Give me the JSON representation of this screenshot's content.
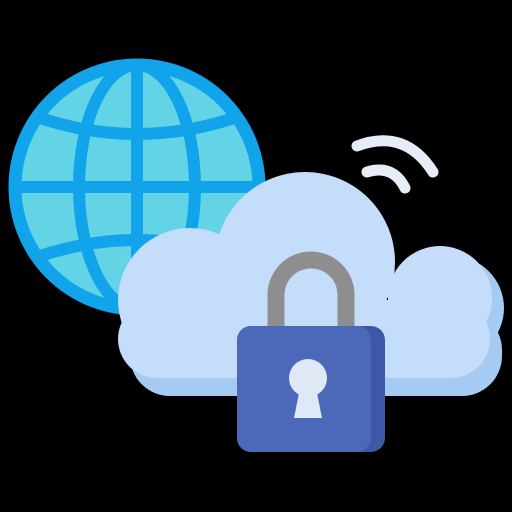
{
  "illustration": {
    "icons": [
      "globe-icon",
      "cloud-icon",
      "wifi-icon",
      "padlock-icon",
      "keyhole-icon"
    ],
    "colors": {
      "background": "#000000",
      "globe_fill": "#63d4e5",
      "globe_lines": "#12a4ea",
      "cloud": "#c4ddfa",
      "cloud_shadow": "#a6cbf3",
      "wifi": "#e6edf7",
      "lock_body": "#4b69b8",
      "lock_shade": "#3d58a6",
      "shackle": "#8e8e8e",
      "keyhole": "#dfe9f6"
    }
  }
}
